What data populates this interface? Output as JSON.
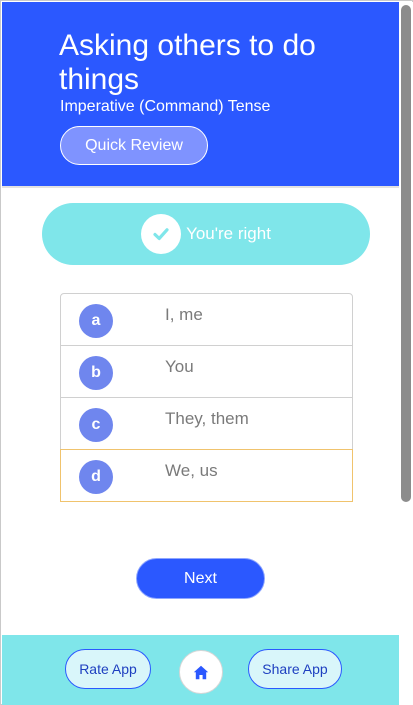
{
  "header": {
    "title": "Asking others to do things",
    "subtitle": "Imperative (Command) Tense",
    "review_label": "Quick Review"
  },
  "feedback": {
    "text": "You're right",
    "icon": "check-icon"
  },
  "options": [
    {
      "letter": "a",
      "text": "I, me",
      "selected": false
    },
    {
      "letter": "b",
      "text": "You",
      "selected": false
    },
    {
      "letter": "c",
      "text": "They, them",
      "selected": false
    },
    {
      "letter": "d",
      "text": "We, us",
      "selected": true
    }
  ],
  "next_label": "Next",
  "footer": {
    "rate_label": "Rate App",
    "share_label": "Share App",
    "home_icon": "home-icon"
  },
  "colors": {
    "primary": "#2b58ff",
    "accent": "#7fe6ea",
    "option_badge": "#6f86ee",
    "selected_border": "#f0c36d"
  }
}
